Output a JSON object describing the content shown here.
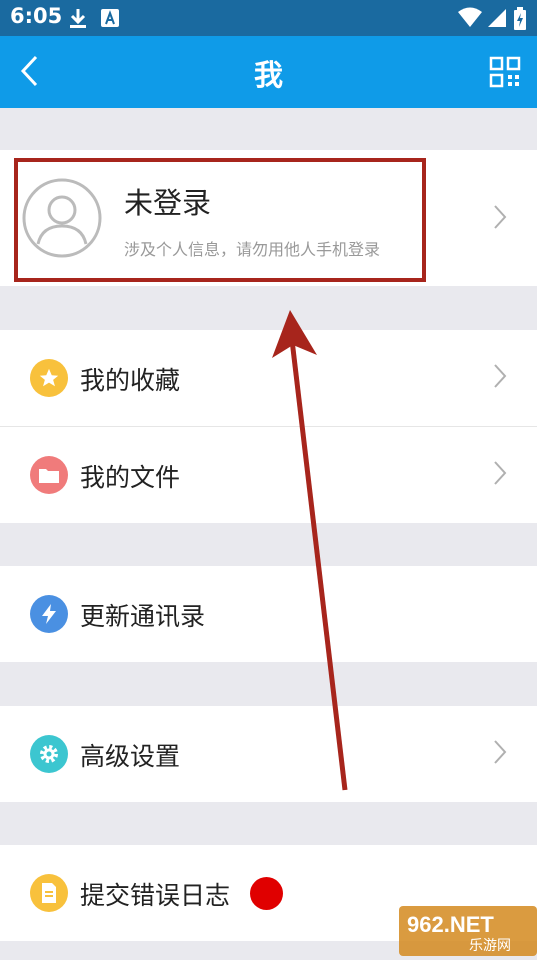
{
  "status_bar": {
    "time": "6:05"
  },
  "header": {
    "title": "我"
  },
  "profile": {
    "name": "未登录",
    "subtitle": "涉及个人信息，请勿用他人手机登录"
  },
  "menu": {
    "favorites": "我的收藏",
    "files": "我的文件",
    "update_contacts": "更新通讯录",
    "advanced_settings": "高级设置",
    "submit_error_log": "提交错误日志"
  },
  "watermark": {
    "logo": "962.NET",
    "text": "乐游网"
  },
  "colors": {
    "status_bar": "#1a6aa0",
    "app_bar": "#0f9be8",
    "favorites_icon": "#f8c13c",
    "files_icon": "#f07b7b",
    "update_icon": "#4a90e2",
    "settings_icon": "#3cc6d0",
    "log_icon": "#f8c13c",
    "annotation": "#a7251c"
  }
}
